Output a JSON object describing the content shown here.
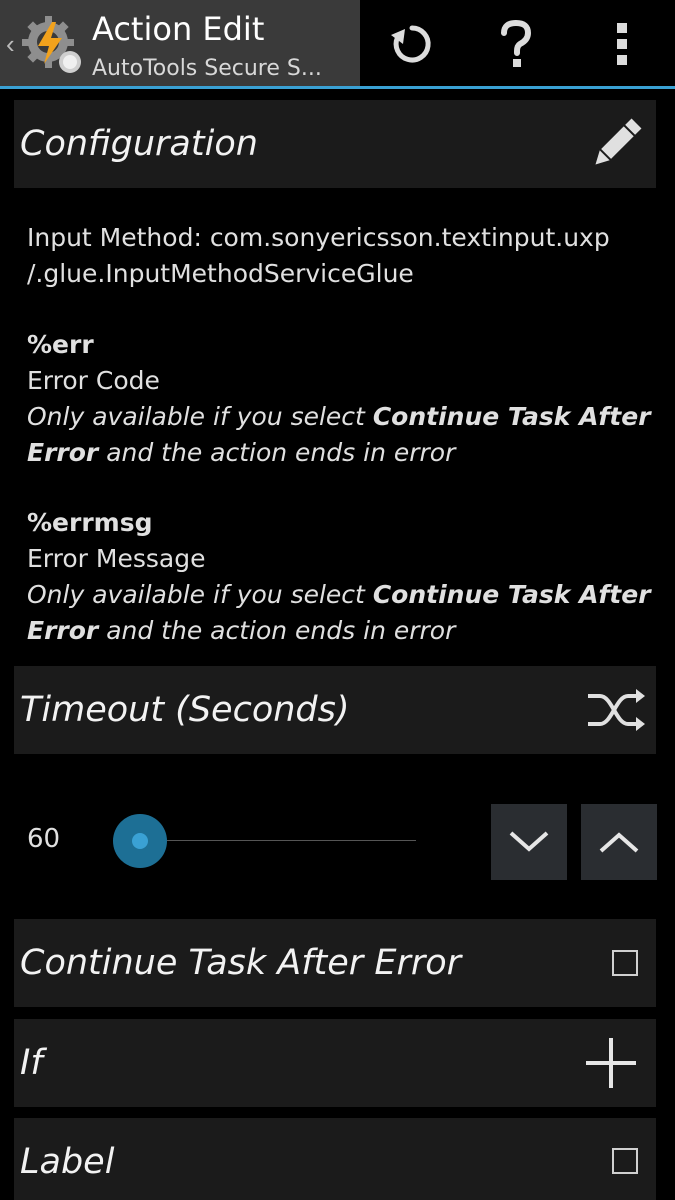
{
  "appbar": {
    "title": "Action Edit",
    "subtitle": "AutoTools Secure S...",
    "icons": [
      "back-chevron-icon",
      "tasker-app-icon",
      "revert-icon",
      "help-icon",
      "overflow-menu-icon"
    ]
  },
  "configuration": {
    "header": "Configuration",
    "edit_icon": "pencil-icon",
    "input_method_line1": "Input Method: com.sonyericsson.textinput.uxp",
    "input_method_line2": "/.glue.InputMethodServiceGlue",
    "vars": [
      {
        "name": "%err",
        "desc": "Error Code",
        "note_pre": "Only available if you select ",
        "note_bold": "Continue Task After Error",
        "note_post": " and the action ends in error"
      },
      {
        "name": "%errmsg",
        "desc": "Error Message",
        "note_pre": "Only available if you select ",
        "note_bold": "Continue Task After Error",
        "note_post": " and the action ends in error"
      }
    ]
  },
  "timeout": {
    "header": "Timeout (Seconds)",
    "icon": "shuffle-icon",
    "value": "60",
    "slider_fraction": 0.0
  },
  "continue_after_error": {
    "label": "Continue Task After Error",
    "checked": false
  },
  "if_row": {
    "label": "If",
    "icon": "plus-icon"
  },
  "label_row": {
    "label": "Label",
    "checked": false
  },
  "colors": {
    "accent": "#3aa1d4",
    "row_bg": "#1b1b1b",
    "titlebar_bg": "#3a3a3a"
  }
}
